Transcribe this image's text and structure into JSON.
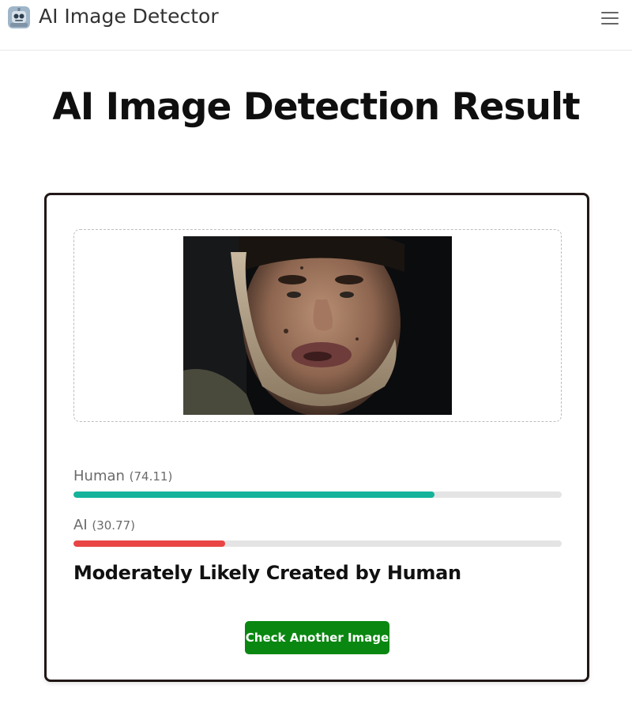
{
  "header": {
    "app_title": "AI Image Detector",
    "logo": "robot-logo-icon",
    "menu_icon": "hamburger-menu-icon"
  },
  "page": {
    "title": "AI Image Detection Result"
  },
  "result": {
    "image_alt": "Uploaded photo of a man with a bandaged jaw",
    "human": {
      "label": "Human",
      "score_text": "(74.11)",
      "fill_fraction": 0.74,
      "color": "#14b39a"
    },
    "ai": {
      "label": "AI",
      "score_text": "(30.77)",
      "fill_fraction": 0.31,
      "color": "#e94545"
    },
    "verdict": "Moderately Likely Created by Human",
    "action_label": "Check Another Image",
    "action_color": "#0a8711"
  }
}
